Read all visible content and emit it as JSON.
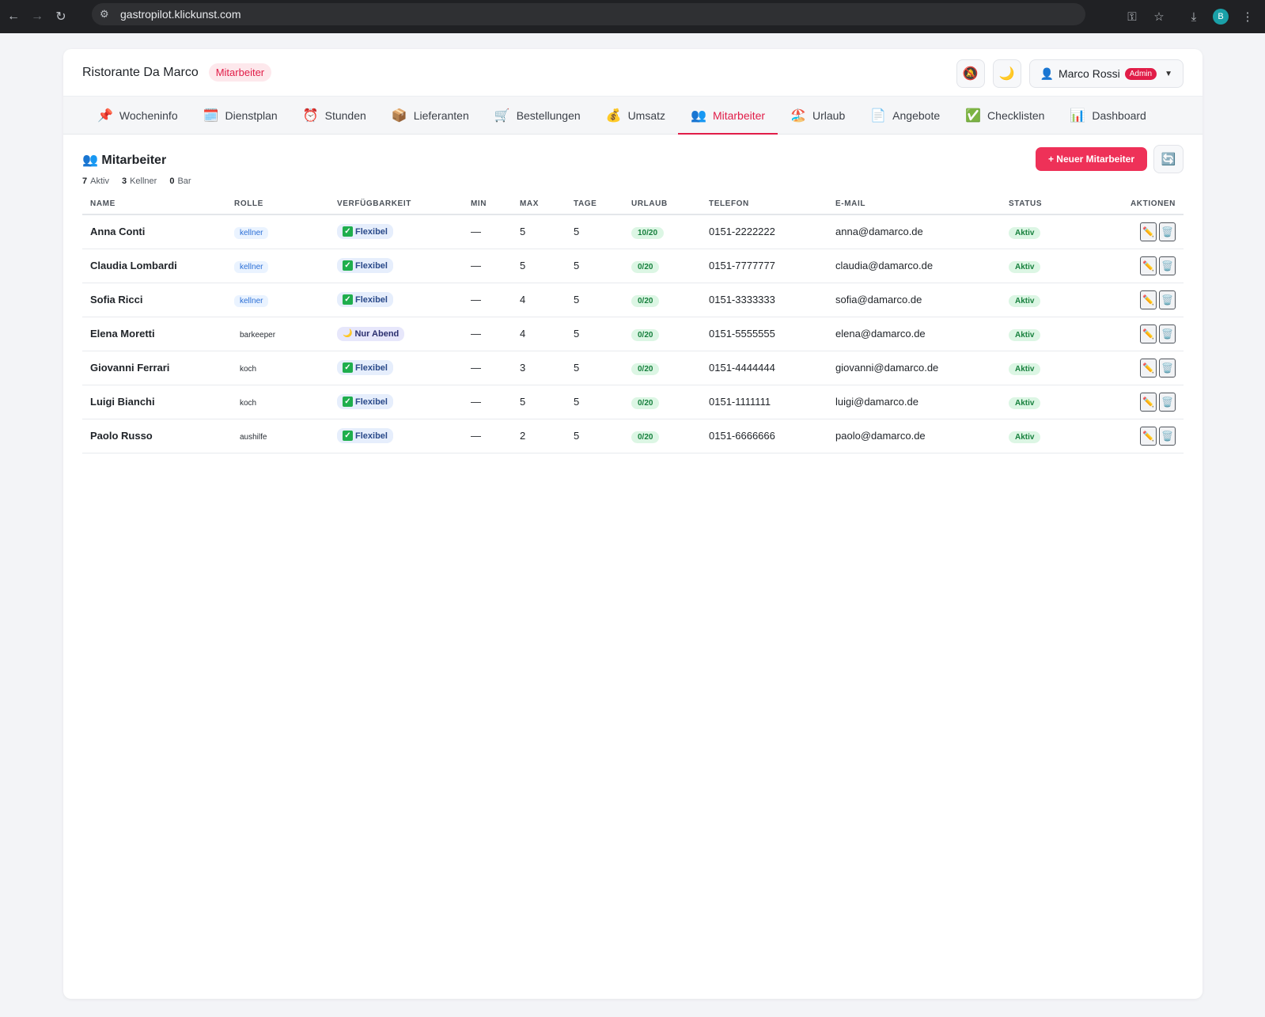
{
  "browser": {
    "url": "gastropilot.klickunst.com",
    "profile_initial": "B"
  },
  "header": {
    "restaurant": "Ristorante Da Marco",
    "section_badge": "Mitarbeiter",
    "user_name": "Marco Rossi",
    "user_role": "Admin"
  },
  "tabs": [
    {
      "icon": "📌",
      "label": "Wocheninfo"
    },
    {
      "icon": "🗓️",
      "label": "Dienstplan"
    },
    {
      "icon": "⏰",
      "label": "Stunden"
    },
    {
      "icon": "📦",
      "label": "Lieferanten"
    },
    {
      "icon": "🛒",
      "label": "Bestellungen"
    },
    {
      "icon": "💰",
      "label": "Umsatz"
    },
    {
      "icon": "👥",
      "label": "Mitarbeiter"
    },
    {
      "icon": "🏖️",
      "label": "Urlaub"
    },
    {
      "icon": "📄",
      "label": "Angebote"
    },
    {
      "icon": "✅",
      "label": "Checklisten"
    },
    {
      "icon": "📊",
      "label": "Dashboard"
    }
  ],
  "section": {
    "title": "👥 Mitarbeiter",
    "new_button": "+ Neuer Mitarbeiter",
    "stats": [
      {
        "value": "7",
        "label": "Aktiv"
      },
      {
        "value": "3",
        "label": "Kellner"
      },
      {
        "value": "0",
        "label": "Bar"
      }
    ]
  },
  "table": {
    "headers": [
      "NAME",
      "ROLLE",
      "VERFÜGBARKEIT",
      "MIN",
      "MAX",
      "TAGE",
      "URLAUB",
      "TELEFON",
      "E-MAIL",
      "STATUS",
      "AKTIONEN"
    ],
    "rows": [
      {
        "name": "Anna Conti",
        "role": "kellner",
        "avail": "Flexibel",
        "min": "—",
        "max": "5",
        "days": "5",
        "vac": "10/20",
        "phone": "0151-2222222",
        "email": "anna@damarco.de",
        "status": "Aktiv"
      },
      {
        "name": "Claudia Lombardi",
        "role": "kellner",
        "avail": "Flexibel",
        "min": "—",
        "max": "5",
        "days": "5",
        "vac": "0/20",
        "phone": "0151-7777777",
        "email": "claudia@damarco.de",
        "status": "Aktiv"
      },
      {
        "name": "Sofia Ricci",
        "role": "kellner",
        "avail": "Flexibel",
        "min": "—",
        "max": "4",
        "days": "5",
        "vac": "0/20",
        "phone": "0151-3333333",
        "email": "sofia@damarco.de",
        "status": "Aktiv"
      },
      {
        "name": "Elena Moretti",
        "role": "barkeeper",
        "avail": "Nur Abend",
        "min": "—",
        "max": "4",
        "days": "5",
        "vac": "0/20",
        "phone": "0151-5555555",
        "email": "elena@damarco.de",
        "status": "Aktiv"
      },
      {
        "name": "Giovanni Ferrari",
        "role": "koch",
        "avail": "Flexibel",
        "min": "—",
        "max": "3",
        "days": "5",
        "vac": "0/20",
        "phone": "0151-4444444",
        "email": "giovanni@damarco.de",
        "status": "Aktiv"
      },
      {
        "name": "Luigi Bianchi",
        "role": "koch",
        "avail": "Flexibel",
        "min": "—",
        "max": "5",
        "days": "5",
        "vac": "0/20",
        "phone": "0151-1111111",
        "email": "luigi@damarco.de",
        "status": "Aktiv"
      },
      {
        "name": "Paolo Russo",
        "role": "aushilfe",
        "avail": "Flexibel",
        "min": "—",
        "max": "2",
        "days": "5",
        "vac": "0/20",
        "phone": "0151-6666666",
        "email": "paolo@damarco.de",
        "status": "Aktiv"
      }
    ]
  },
  "colors": {
    "accent": "#e11d48",
    "primary_button": "#ee3158",
    "status_green": "#17803d"
  }
}
